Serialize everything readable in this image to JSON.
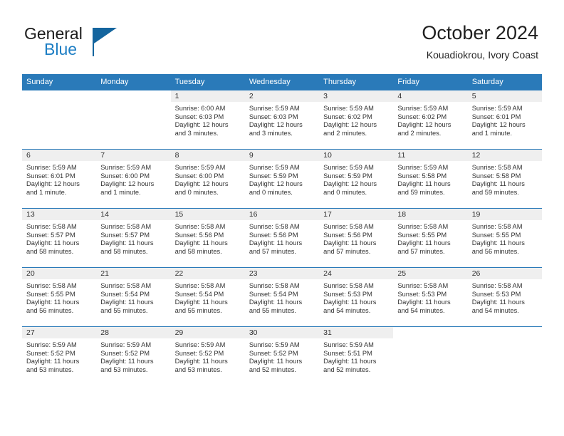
{
  "brand": {
    "word1": "General",
    "word2": "Blue",
    "accent_color": "#1d7ec4",
    "flag_color": "#14659e"
  },
  "header": {
    "title": "October 2024",
    "subtitle": "Kouadiokrou, Ivory Coast"
  },
  "theme": {
    "header_bar_color": "#2a7ab9",
    "daynum_strip_color": "#efefef"
  },
  "weekday_headers": [
    "Sunday",
    "Monday",
    "Tuesday",
    "Wednesday",
    "Thursday",
    "Friday",
    "Saturday"
  ],
  "weeks": [
    [
      {
        "day": "",
        "lines": []
      },
      {
        "day": "",
        "lines": []
      },
      {
        "day": "1",
        "lines": [
          "Sunrise: 6:00 AM",
          "Sunset: 6:03 PM",
          "Daylight: 12 hours",
          "and 3 minutes."
        ]
      },
      {
        "day": "2",
        "lines": [
          "Sunrise: 5:59 AM",
          "Sunset: 6:03 PM",
          "Daylight: 12 hours",
          "and 3 minutes."
        ]
      },
      {
        "day": "3",
        "lines": [
          "Sunrise: 5:59 AM",
          "Sunset: 6:02 PM",
          "Daylight: 12 hours",
          "and 2 minutes."
        ]
      },
      {
        "day": "4",
        "lines": [
          "Sunrise: 5:59 AM",
          "Sunset: 6:02 PM",
          "Daylight: 12 hours",
          "and 2 minutes."
        ]
      },
      {
        "day": "5",
        "lines": [
          "Sunrise: 5:59 AM",
          "Sunset: 6:01 PM",
          "Daylight: 12 hours",
          "and 1 minute."
        ]
      }
    ],
    [
      {
        "day": "6",
        "lines": [
          "Sunrise: 5:59 AM",
          "Sunset: 6:01 PM",
          "Daylight: 12 hours",
          "and 1 minute."
        ]
      },
      {
        "day": "7",
        "lines": [
          "Sunrise: 5:59 AM",
          "Sunset: 6:00 PM",
          "Daylight: 12 hours",
          "and 1 minute."
        ]
      },
      {
        "day": "8",
        "lines": [
          "Sunrise: 5:59 AM",
          "Sunset: 6:00 PM",
          "Daylight: 12 hours",
          "and 0 minutes."
        ]
      },
      {
        "day": "9",
        "lines": [
          "Sunrise: 5:59 AM",
          "Sunset: 5:59 PM",
          "Daylight: 12 hours",
          "and 0 minutes."
        ]
      },
      {
        "day": "10",
        "lines": [
          "Sunrise: 5:59 AM",
          "Sunset: 5:59 PM",
          "Daylight: 12 hours",
          "and 0 minutes."
        ]
      },
      {
        "day": "11",
        "lines": [
          "Sunrise: 5:59 AM",
          "Sunset: 5:58 PM",
          "Daylight: 11 hours",
          "and 59 minutes."
        ]
      },
      {
        "day": "12",
        "lines": [
          "Sunrise: 5:58 AM",
          "Sunset: 5:58 PM",
          "Daylight: 11 hours",
          "and 59 minutes."
        ]
      }
    ],
    [
      {
        "day": "13",
        "lines": [
          "Sunrise: 5:58 AM",
          "Sunset: 5:57 PM",
          "Daylight: 11 hours",
          "and 58 minutes."
        ]
      },
      {
        "day": "14",
        "lines": [
          "Sunrise: 5:58 AM",
          "Sunset: 5:57 PM",
          "Daylight: 11 hours",
          "and 58 minutes."
        ]
      },
      {
        "day": "15",
        "lines": [
          "Sunrise: 5:58 AM",
          "Sunset: 5:56 PM",
          "Daylight: 11 hours",
          "and 58 minutes."
        ]
      },
      {
        "day": "16",
        "lines": [
          "Sunrise: 5:58 AM",
          "Sunset: 5:56 PM",
          "Daylight: 11 hours",
          "and 57 minutes."
        ]
      },
      {
        "day": "17",
        "lines": [
          "Sunrise: 5:58 AM",
          "Sunset: 5:56 PM",
          "Daylight: 11 hours",
          "and 57 minutes."
        ]
      },
      {
        "day": "18",
        "lines": [
          "Sunrise: 5:58 AM",
          "Sunset: 5:55 PM",
          "Daylight: 11 hours",
          "and 57 minutes."
        ]
      },
      {
        "day": "19",
        "lines": [
          "Sunrise: 5:58 AM",
          "Sunset: 5:55 PM",
          "Daylight: 11 hours",
          "and 56 minutes."
        ]
      }
    ],
    [
      {
        "day": "20",
        "lines": [
          "Sunrise: 5:58 AM",
          "Sunset: 5:55 PM",
          "Daylight: 11 hours",
          "and 56 minutes."
        ]
      },
      {
        "day": "21",
        "lines": [
          "Sunrise: 5:58 AM",
          "Sunset: 5:54 PM",
          "Daylight: 11 hours",
          "and 55 minutes."
        ]
      },
      {
        "day": "22",
        "lines": [
          "Sunrise: 5:58 AM",
          "Sunset: 5:54 PM",
          "Daylight: 11 hours",
          "and 55 minutes."
        ]
      },
      {
        "day": "23",
        "lines": [
          "Sunrise: 5:58 AM",
          "Sunset: 5:54 PM",
          "Daylight: 11 hours",
          "and 55 minutes."
        ]
      },
      {
        "day": "24",
        "lines": [
          "Sunrise: 5:58 AM",
          "Sunset: 5:53 PM",
          "Daylight: 11 hours",
          "and 54 minutes."
        ]
      },
      {
        "day": "25",
        "lines": [
          "Sunrise: 5:58 AM",
          "Sunset: 5:53 PM",
          "Daylight: 11 hours",
          "and 54 minutes."
        ]
      },
      {
        "day": "26",
        "lines": [
          "Sunrise: 5:58 AM",
          "Sunset: 5:53 PM",
          "Daylight: 11 hours",
          "and 54 minutes."
        ]
      }
    ],
    [
      {
        "day": "27",
        "lines": [
          "Sunrise: 5:59 AM",
          "Sunset: 5:52 PM",
          "Daylight: 11 hours",
          "and 53 minutes."
        ]
      },
      {
        "day": "28",
        "lines": [
          "Sunrise: 5:59 AM",
          "Sunset: 5:52 PM",
          "Daylight: 11 hours",
          "and 53 minutes."
        ]
      },
      {
        "day": "29",
        "lines": [
          "Sunrise: 5:59 AM",
          "Sunset: 5:52 PM",
          "Daylight: 11 hours",
          "and 53 minutes."
        ]
      },
      {
        "day": "30",
        "lines": [
          "Sunrise: 5:59 AM",
          "Sunset: 5:52 PM",
          "Daylight: 11 hours",
          "and 52 minutes."
        ]
      },
      {
        "day": "31",
        "lines": [
          "Sunrise: 5:59 AM",
          "Sunset: 5:51 PM",
          "Daylight: 11 hours",
          "and 52 minutes."
        ]
      },
      {
        "day": "",
        "lines": []
      },
      {
        "day": "",
        "lines": []
      }
    ]
  ]
}
